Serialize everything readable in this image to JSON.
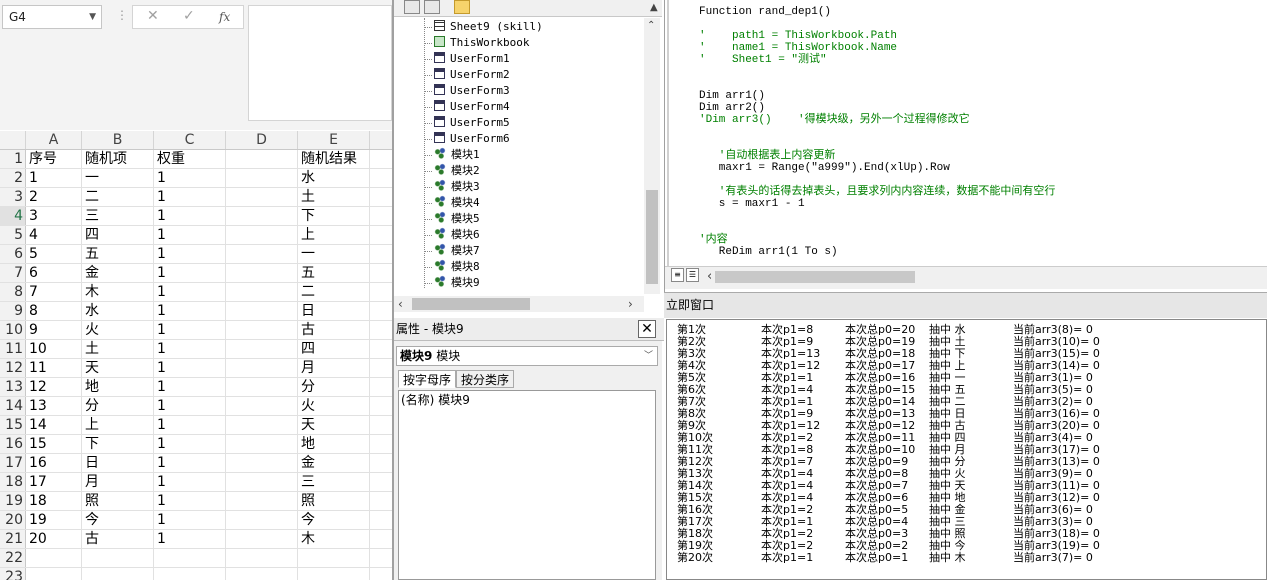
{
  "excel": {
    "name_box": "G4",
    "fx_label": "fx",
    "cancel_glyph": "✕",
    "enter_glyph": "✓",
    "columns": [
      "A",
      "B",
      "C",
      "D",
      "E"
    ],
    "rows": [
      {
        "n": "1",
        "a": "序号",
        "b": "随机项",
        "c": "权重",
        "e": "随机结果"
      },
      {
        "n": "2",
        "a": "1",
        "b": "一",
        "c": "1",
        "e": "水"
      },
      {
        "n": "3",
        "a": "2",
        "b": "二",
        "c": "1",
        "e": "土"
      },
      {
        "n": "4",
        "a": "3",
        "b": "三",
        "c": "1",
        "e": "下"
      },
      {
        "n": "5",
        "a": "4",
        "b": "四",
        "c": "1",
        "e": "上"
      },
      {
        "n": "6",
        "a": "5",
        "b": "五",
        "c": "1",
        "e": "一"
      },
      {
        "n": "7",
        "a": "6",
        "b": "金",
        "c": "1",
        "e": "五"
      },
      {
        "n": "8",
        "a": "7",
        "b": "木",
        "c": "1",
        "e": "二"
      },
      {
        "n": "9",
        "a": "8",
        "b": "水",
        "c": "1",
        "e": "日"
      },
      {
        "n": "10",
        "a": "9",
        "b": "火",
        "c": "1",
        "e": "古"
      },
      {
        "n": "11",
        "a": "10",
        "b": "土",
        "c": "1",
        "e": "四"
      },
      {
        "n": "12",
        "a": "11",
        "b": "天",
        "c": "1",
        "e": "月"
      },
      {
        "n": "13",
        "a": "12",
        "b": "地",
        "c": "1",
        "e": "分"
      },
      {
        "n": "14",
        "a": "13",
        "b": "分",
        "c": "1",
        "e": "火"
      },
      {
        "n": "15",
        "a": "14",
        "b": "上",
        "c": "1",
        "e": "天"
      },
      {
        "n": "16",
        "a": "15",
        "b": "下",
        "c": "1",
        "e": "地"
      },
      {
        "n": "17",
        "a": "16",
        "b": "日",
        "c": "1",
        "e": "金"
      },
      {
        "n": "18",
        "a": "17",
        "b": "月",
        "c": "1",
        "e": "三"
      },
      {
        "n": "19",
        "a": "18",
        "b": "照",
        "c": "1",
        "e": "照"
      },
      {
        "n": "20",
        "a": "19",
        "b": "今",
        "c": "1",
        "e": "今"
      },
      {
        "n": "21",
        "a": "20",
        "b": "古",
        "c": "1",
        "e": "木"
      },
      {
        "n": "22",
        "a": "",
        "b": "",
        "c": "",
        "e": ""
      },
      {
        "n": "23",
        "a": "",
        "b": "",
        "c": "",
        "e": ""
      }
    ]
  },
  "project": {
    "items": [
      {
        "label": "Sheet9 (skill)",
        "icon": "sheet-icon"
      },
      {
        "label": "ThisWorkbook",
        "icon": "workbook-icon"
      },
      {
        "label": "UserForm1",
        "icon": "form-icon"
      },
      {
        "label": "UserForm2",
        "icon": "form-icon"
      },
      {
        "label": "UserForm3",
        "icon": "form-icon"
      },
      {
        "label": "UserForm4",
        "icon": "form-icon"
      },
      {
        "label": "UserForm5",
        "icon": "form-icon"
      },
      {
        "label": "UserForm6",
        "icon": "form-icon"
      },
      {
        "label": "模块1",
        "icon": "module-icon"
      },
      {
        "label": "模块2",
        "icon": "module-icon"
      },
      {
        "label": "模块3",
        "icon": "module-icon"
      },
      {
        "label": "模块4",
        "icon": "module-icon"
      },
      {
        "label": "模块5",
        "icon": "module-icon"
      },
      {
        "label": "模块6",
        "icon": "module-icon"
      },
      {
        "label": "模块7",
        "icon": "module-icon"
      },
      {
        "label": "模块8",
        "icon": "module-icon"
      },
      {
        "label": "模块9",
        "icon": "module-icon"
      }
    ]
  },
  "properties": {
    "title": "属性 - 模块9",
    "close": "✕",
    "object_name": "模块9",
    "object_type": "模块",
    "tabs": [
      "按字母序",
      "按分类序"
    ],
    "row_name": "(名称)",
    "row_value": "模块9"
  },
  "code": {
    "lines": [
      {
        "text": "Function rand_dep1()",
        "green": false
      },
      {
        "text": "",
        "green": false
      },
      {
        "text": "'    path1 = ThisWorkbook.Path",
        "green": true
      },
      {
        "text": "'    name1 = ThisWorkbook.Name",
        "green": true
      },
      {
        "text": "'    Sheet1 = \"测试\"",
        "green": true
      },
      {
        "text": "",
        "green": false
      },
      {
        "text": "",
        "green": false
      },
      {
        "text": "Dim arr1()",
        "green": false
      },
      {
        "text": "Dim arr2()",
        "green": false
      },
      {
        "text": "'Dim arr3()    '得模块级，另外一个过程得修改它",
        "green": true
      },
      {
        "text": "",
        "green": false
      },
      {
        "text": "",
        "green": false
      },
      {
        "text": "   '自动根据表上内容更新",
        "green": true
      },
      {
        "text": "   maxr1 = Range(\"a999\").End(xlUp).Row",
        "green": false
      },
      {
        "text": "",
        "green": false
      },
      {
        "text": "   '有表头的话得去掉表头，且要求列内内容连续，数据不能中间有空行",
        "green": true
      },
      {
        "text": "   s = maxr1 - 1",
        "green": false
      },
      {
        "text": "",
        "green": false
      },
      {
        "text": "",
        "green": false
      },
      {
        "text": "'内容",
        "green": true
      },
      {
        "text": "   ReDim arr1(1 To s)",
        "green": false
      }
    ]
  },
  "immediate": {
    "title": "立即窗口",
    "rows": [
      [
        "第1次",
        "本次p1=8",
        "本次总p0=20",
        "抽中 水",
        "当前arr3(8)= 0"
      ],
      [
        "第2次",
        "本次p1=9",
        "本次总p0=19",
        "抽中 土",
        "当前arr3(10)= 0"
      ],
      [
        "第3次",
        "本次p1=13",
        "本次总p0=18",
        "抽中 下",
        "当前arr3(15)= 0"
      ],
      [
        "第4次",
        "本次p1=12",
        "本次总p0=17",
        "抽中 上",
        "当前arr3(14)= 0"
      ],
      [
        "第5次",
        "本次p1=1",
        "本次总p0=16",
        "抽中 一",
        "当前arr3(1)= 0"
      ],
      [
        "第6次",
        "本次p1=4",
        "本次总p0=15",
        "抽中 五",
        "当前arr3(5)= 0"
      ],
      [
        "第7次",
        "本次p1=1",
        "本次总p0=14",
        "抽中 二",
        "当前arr3(2)= 0"
      ],
      [
        "第8次",
        "本次p1=9",
        "本次总p0=13",
        "抽中 日",
        "当前arr3(16)= 0"
      ],
      [
        "第9次",
        "本次p1=12",
        "本次总p0=12",
        "抽中 古",
        "当前arr3(20)= 0"
      ],
      [
        "第10次",
        "本次p1=2",
        "本次总p0=11",
        "抽中 四",
        "当前arr3(4)= 0"
      ],
      [
        "第11次",
        "本次p1=8",
        "本次总p0=10",
        "抽中 月",
        "当前arr3(17)= 0"
      ],
      [
        "第12次",
        "本次p1=7",
        "本次总p0=9",
        "抽中 分",
        "当前arr3(13)= 0"
      ],
      [
        "第13次",
        "本次p1=4",
        "本次总p0=8",
        "抽中 火",
        "当前arr3(9)= 0"
      ],
      [
        "第14次",
        "本次p1=4",
        "本次总p0=7",
        "抽中 天",
        "当前arr3(11)= 0"
      ],
      [
        "第15次",
        "本次p1=4",
        "本次总p0=6",
        "抽中 地",
        "当前arr3(12)= 0"
      ],
      [
        "第16次",
        "本次p1=2",
        "本次总p0=5",
        "抽中 金",
        "当前arr3(6)= 0"
      ],
      [
        "第17次",
        "本次p1=1",
        "本次总p0=4",
        "抽中 三",
        "当前arr3(3)= 0"
      ],
      [
        "第18次",
        "本次p1=2",
        "本次总p0=3",
        "抽中 照",
        "当前arr3(18)= 0"
      ],
      [
        "第19次",
        "本次p1=2",
        "本次总p0=2",
        "抽中 今",
        "当前arr3(19)= 0"
      ],
      [
        "第20次",
        "本次p1=1",
        "本次总p0=1",
        "抽中 木",
        "当前arr3(7)= 0"
      ]
    ]
  }
}
